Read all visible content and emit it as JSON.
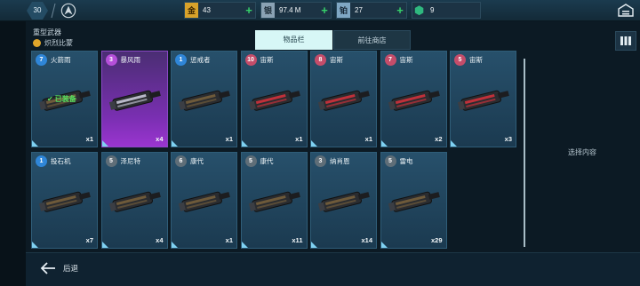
{
  "topbar": {
    "level": "30",
    "resources": [
      {
        "icon": "gold-icon",
        "glyph": "金",
        "color": "#d8a22a",
        "value": "43"
      },
      {
        "icon": "silver-icon",
        "glyph": "银",
        "color": "#8aa2b4",
        "value": "97.4 M"
      },
      {
        "icon": "platinum-icon",
        "glyph": "铂",
        "color": "#7fa7c4",
        "value": "27"
      },
      {
        "icon": "gem-icon",
        "glyph": "⬢",
        "color": "#2fb87f",
        "value": "9"
      }
    ]
  },
  "category": {
    "title": "重型武器",
    "subtitle": "炽烈比蒙"
  },
  "tabs": {
    "inventory": "物品栏",
    "shop": "前往商店"
  },
  "equipped_label": "已装备",
  "items": [
    {
      "level": "7",
      "name": "火箭雨",
      "qty": "x1",
      "rarity": "blue",
      "equipped": true
    },
    {
      "level": "3",
      "name": "暴风雨",
      "qty": "x4",
      "rarity": "purple",
      "equipped": false
    },
    {
      "level": "1",
      "name": "惩戒者",
      "qty": "x1",
      "rarity": "blue",
      "equipped": false
    },
    {
      "level": "10",
      "name": "宙斯",
      "qty": "x1",
      "rarity": "red",
      "equipped": false
    },
    {
      "level": "8",
      "name": "宙斯",
      "qty": "x1",
      "rarity": "red",
      "equipped": false
    },
    {
      "level": "7",
      "name": "宙斯",
      "qty": "x2",
      "rarity": "red",
      "equipped": false
    },
    {
      "level": "5",
      "name": "宙斯",
      "qty": "x3",
      "rarity": "red",
      "equipped": false
    },
    {
      "level": "1",
      "name": "投石机",
      "qty": "x7",
      "rarity": "blue",
      "equipped": false
    },
    {
      "level": "5",
      "name": "泽尼特",
      "qty": "x4",
      "rarity": "gray",
      "equipped": false
    },
    {
      "level": "6",
      "name": "康代",
      "qty": "x1",
      "rarity": "gray",
      "equipped": false
    },
    {
      "level": "5",
      "name": "康代",
      "qty": "x11",
      "rarity": "gray",
      "equipped": false
    },
    {
      "level": "3",
      "name": "纳肖恩",
      "qty": "x14",
      "rarity": "gray",
      "equipped": false
    },
    {
      "level": "5",
      "name": "雷电",
      "qty": "x29",
      "rarity": "gray",
      "equipped": false
    }
  ],
  "detail_hint": "选择内容",
  "back_label": "后退"
}
